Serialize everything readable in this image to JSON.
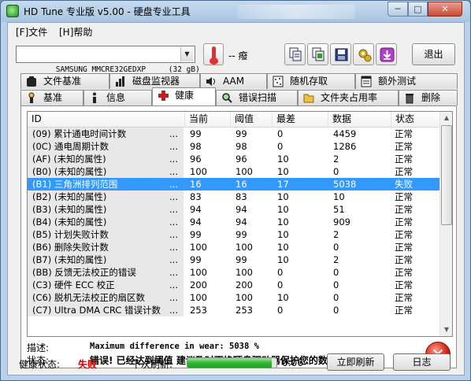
{
  "window": {
    "title": "HD Tune 专业版 v5.00 - 硬盘专业工具",
    "min_glyph": "─",
    "max_glyph": "□",
    "close_glyph": "✕"
  },
  "menu": {
    "file": "[F]文件",
    "help": "[H]帮助"
  },
  "toolbar": {
    "drive": "SAMSUNG MMCRE32GEDXP     (32 gB)",
    "dropdown_glyph": "▼",
    "temperature": "-- 癈",
    "exit_label": "退出",
    "icons": [
      "copy-icon",
      "copy-all-icon",
      "save-icon",
      "settings-icon",
      "download-icon"
    ]
  },
  "tabs": {
    "row1": [
      "文件基准",
      "磁盘监视器",
      "AAM",
      "随机存取",
      "额外测试"
    ],
    "row2": [
      "基准",
      "信息",
      "健康",
      "错误扫描",
      "文件夹占用率",
      "删除"
    ],
    "active": "健康"
  },
  "table": {
    "headers": [
      "ID",
      "当前",
      "阈值",
      "最差",
      "数据",
      "状态"
    ],
    "dots": "...",
    "rows": [
      {
        "id": "(09) 累计通电时间计数",
        "cur": "99",
        "thr": "99",
        "wor": "0",
        "dat": "4459",
        "sta": "正常"
      },
      {
        "id": "(0C) 通电周期计数",
        "cur": "98",
        "thr": "98",
        "wor": "0",
        "dat": "1286",
        "sta": "正常"
      },
      {
        "id": "(AF) (未知的属性)",
        "cur": "96",
        "thr": "96",
        "wor": "10",
        "dat": "2",
        "sta": "正常"
      },
      {
        "id": "(B0) (未知的属性)",
        "cur": "100",
        "thr": "100",
        "wor": "10",
        "dat": "0",
        "sta": "正常"
      },
      {
        "id": "(B1) 三角洲排列范围",
        "cur": "16",
        "thr": "16",
        "wor": "17",
        "dat": "5038",
        "sta": "失败",
        "fail": true
      },
      {
        "id": "(B2) (未知的属性)",
        "cur": "83",
        "thr": "83",
        "wor": "10",
        "dat": "10",
        "sta": "正常"
      },
      {
        "id": "(B3) (未知的属性)",
        "cur": "94",
        "thr": "94",
        "wor": "10",
        "dat": "51",
        "sta": "正常"
      },
      {
        "id": "(B4) (未知的属性)",
        "cur": "94",
        "thr": "94",
        "wor": "10",
        "dat": "909",
        "sta": "正常"
      },
      {
        "id": "(B5) 计划失败计数",
        "cur": "99",
        "thr": "99",
        "wor": "10",
        "dat": "2",
        "sta": "正常"
      },
      {
        "id": "(B6) 删除失败计数",
        "cur": "100",
        "thr": "100",
        "wor": "10",
        "dat": "0",
        "sta": "正常"
      },
      {
        "id": "(B7) (未知的属性)",
        "cur": "99",
        "thr": "99",
        "wor": "10",
        "dat": "2",
        "sta": "正常"
      },
      {
        "id": "(BB) 反馈无法校正的错误",
        "cur": "100",
        "thr": "100",
        "wor": "0",
        "dat": "0",
        "sta": "正常"
      },
      {
        "id": "(C3) 硬件 ECC 校正",
        "cur": "200",
        "thr": "200",
        "wor": "0",
        "dat": "0",
        "sta": "正常"
      },
      {
        "id": "(C6) 脱机无法校正的扇区数",
        "cur": "100",
        "thr": "100",
        "wor": "10",
        "dat": "0",
        "sta": "正常"
      },
      {
        "id": "(C7) Ultra DMA CRC 错误计数",
        "cur": "253",
        "thr": "253",
        "wor": "0",
        "dat": "0",
        "sta": "正常"
      }
    ]
  },
  "details": {
    "desc_label": "描述:",
    "desc_value": "Maximum difference in wear: 5038 %",
    "status_label": "状态:",
    "status_value": "错误! 已经达到阈值 建议及时更换硬盘驱动器保护您的数据安全。",
    "fail_glyph": "✕"
  },
  "footer": {
    "health_label": "健康状态:",
    "health_value": "失败",
    "refresh_label": "下次刷新:",
    "progress_fraction": 0.95,
    "timer": "0:06",
    "refresh_button": "立即刷新",
    "log_button": "日志"
  },
  "colors": {
    "accent_selection": "#3399ff",
    "fail_text": "#d00000",
    "progress": "#33b633"
  }
}
